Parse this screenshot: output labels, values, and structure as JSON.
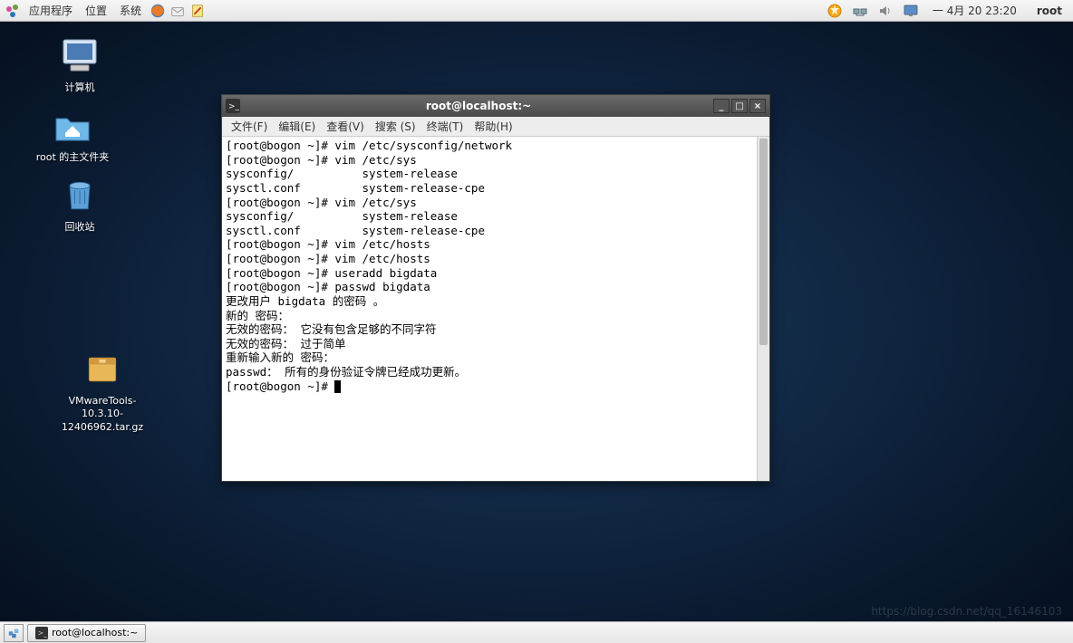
{
  "top_panel": {
    "menus": [
      "应用程序",
      "位置",
      "系统"
    ],
    "clock": "一 4月 20 23:20",
    "user": "root"
  },
  "desktop_icons": {
    "computer": "计算机",
    "home": "root 的主文件夹",
    "trash": "回收站",
    "archive": "VMwareTools-10.3.10-12406962.tar.gz"
  },
  "terminal": {
    "title": "root@localhost:~",
    "menus": [
      "文件(F)",
      "编辑(E)",
      "查看(V)",
      "搜索 (S)",
      "终端(T)",
      "帮助(H)"
    ],
    "lines": [
      "[root@bogon ~]# vim /etc/sysconfig/network",
      "[root@bogon ~]# vim /etc/sys",
      "sysconfig/          system-release",
      "sysctl.conf         system-release-cpe",
      "[root@bogon ~]# vim /etc/sys",
      "sysconfig/          system-release",
      "sysctl.conf         system-release-cpe",
      "[root@bogon ~]# vim /etc/hosts",
      "[root@bogon ~]# vim /etc/hosts",
      "[root@bogon ~]# useradd bigdata",
      "[root@bogon ~]# passwd bigdata",
      "更改用户 bigdata 的密码 。",
      "新的 密码：",
      "无效的密码： 它没有包含足够的不同字符",
      "无效的密码： 过于简单",
      "重新输入新的 密码：",
      "passwd： 所有的身份验证令牌已经成功更新。",
      "[root@bogon ~]# "
    ]
  },
  "bottom_panel": {
    "task": "root@localhost:~"
  },
  "watermark": "https://blog.csdn.net/qq_16146103"
}
